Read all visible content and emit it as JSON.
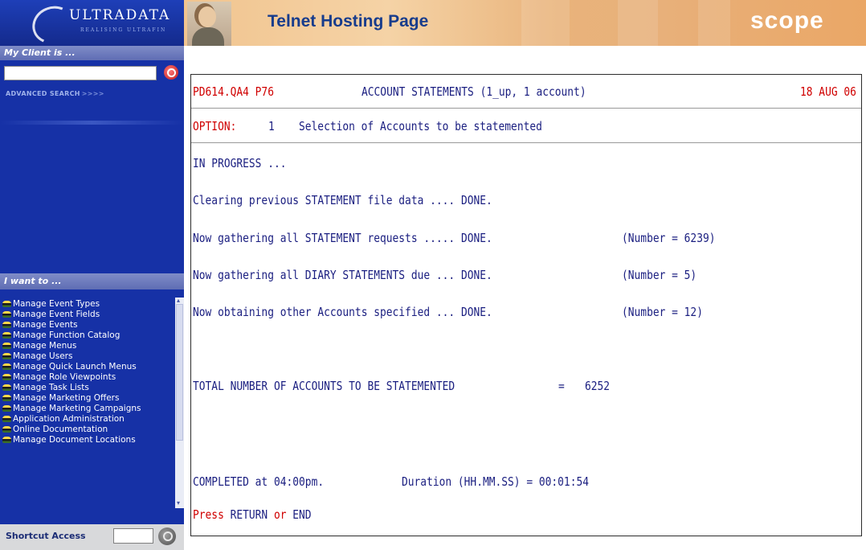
{
  "sidebar": {
    "logo_text": "ULTRADATA",
    "logo_tagline": "REALISING ULTRAFIN",
    "client_header": "My Client is ...",
    "advanced_search": "ADVANCED SEARCH",
    "advanced_search_chevrons": ">>>>",
    "iwant_header": "I want to ...",
    "menu_items": [
      "Manage Event Types",
      "Manage Event Fields",
      "Manage Events",
      "Manage Function Catalog",
      "Manage Menus",
      "Manage Users",
      "Manage Quick Launch Menus",
      "Manage Role Viewpoints",
      "Manage Task Lists",
      "Manage Marketing Offers",
      "Manage Marketing Campaigns",
      "Application Administration",
      "Online Documentation",
      "Manage Document Locations"
    ],
    "shortcut_label": "Shortcut Access"
  },
  "banner": {
    "title": "Telnet Hosting Page",
    "brand": "scope"
  },
  "terminal": {
    "program": "PD614.QA4 P76",
    "screen_title": "ACCOUNT STATEMENTS (1_up, 1 account)",
    "date": "18 AUG 06",
    "option_label": "OPTION:",
    "option_number": "1",
    "option_text": "Selection of Accounts to be statemented",
    "in_progress": "IN PROGRESS ...",
    "step1": "Clearing previous STATEMENT file data .... DONE.",
    "step2": "Now gathering all STATEMENT requests ..... DONE.",
    "step2_count": "(Number = 6239)",
    "step3": "Now gathering all DIARY STATEMENTS due ... DONE.",
    "step3_count": "(Number = 5)",
    "step4": "Now obtaining other Accounts specified ... DONE.",
    "step4_count": "(Number = 12)",
    "total_label": "TOTAL NUMBER OF ACCOUNTS TO BE STATEMENTED",
    "total_eq": "=",
    "total_value": "6252",
    "completed": "COMPLETED at 04:00pm.",
    "duration": "Duration (HH.MM.SS) = 00:01:54",
    "press": "Press",
    "return_key": "RETURN",
    "or": "or",
    "end_key": "END"
  }
}
